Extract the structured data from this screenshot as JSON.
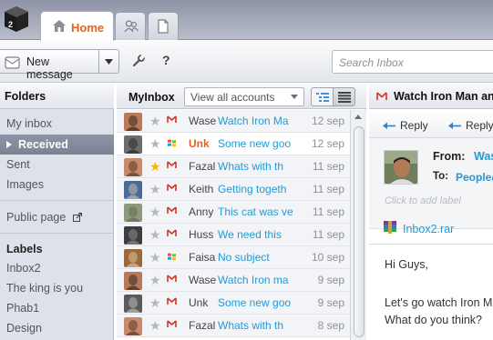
{
  "tabs": {
    "home_label": "Home",
    "accent_color": "#e2641e"
  },
  "toolbar": {
    "new_message_label": "New message",
    "help_label": "?",
    "search_placeholder": "Search Inbox"
  },
  "folders": {
    "title": "Folders",
    "items": [
      "My inbox",
      "Received",
      "Sent",
      "Images"
    ],
    "selected": "Received",
    "public_page": "Public page",
    "labels_title": "Labels",
    "labels": [
      "Inbox2",
      "The king is you",
      "Phab1",
      "Design"
    ]
  },
  "list": {
    "title": "MyInbox",
    "account_filter": "View all accounts",
    "rows": [
      {
        "sender": "Wase",
        "subject": "Watch Iron Ma",
        "date": "12 sep",
        "starred": false,
        "service": "gmail",
        "unread": false
      },
      {
        "sender": "Unk",
        "subject": "Some new goo",
        "date": "12 sep",
        "starred": false,
        "service": "windows",
        "unread": true
      },
      {
        "sender": "Fazal",
        "subject": "Whats with th",
        "date": "11 sep",
        "starred": true,
        "service": "gmail",
        "unread": false
      },
      {
        "sender": "Keith",
        "subject": "Getting togeth",
        "date": "11 sep",
        "starred": false,
        "service": "gmail",
        "unread": false
      },
      {
        "sender": "Anny",
        "subject": "This cat was ve",
        "date": "11 sep",
        "starred": false,
        "service": "gmail",
        "unread": false
      },
      {
        "sender": "Huss",
        "subject": "We need this",
        "date": "11 sep",
        "starred": false,
        "service": "gmail",
        "unread": false
      },
      {
        "sender": "Faisal",
        "subject": "No subject",
        "date": "10 sep",
        "starred": false,
        "service": "windows",
        "unread": false
      },
      {
        "sender": "Wase",
        "subject": "Watch Iron ma",
        "date": "9 sep",
        "starred": false,
        "service": "gmail",
        "unread": false
      },
      {
        "sender": "Unk",
        "subject": "Some new goo",
        "date": "9 sep",
        "starred": false,
        "service": "gmail",
        "unread": false
      },
      {
        "sender": "Fazal",
        "subject": "Whats with th",
        "date": "8 sep",
        "starred": false,
        "service": "gmail",
        "unread": false
      }
    ]
  },
  "reader": {
    "title": "Watch Iron Man an",
    "reply_label": "Reply",
    "reply_all_label": "Reply",
    "from_label": "From:",
    "from_value": "Was",
    "to_label": "To:",
    "to_value": "People@",
    "add_label_hint": "Click to add label",
    "attachment": "Inbox2.rar",
    "body": [
      "Hi Guys,",
      "Let's go watch Iron M",
      "What do you think?"
    ]
  }
}
